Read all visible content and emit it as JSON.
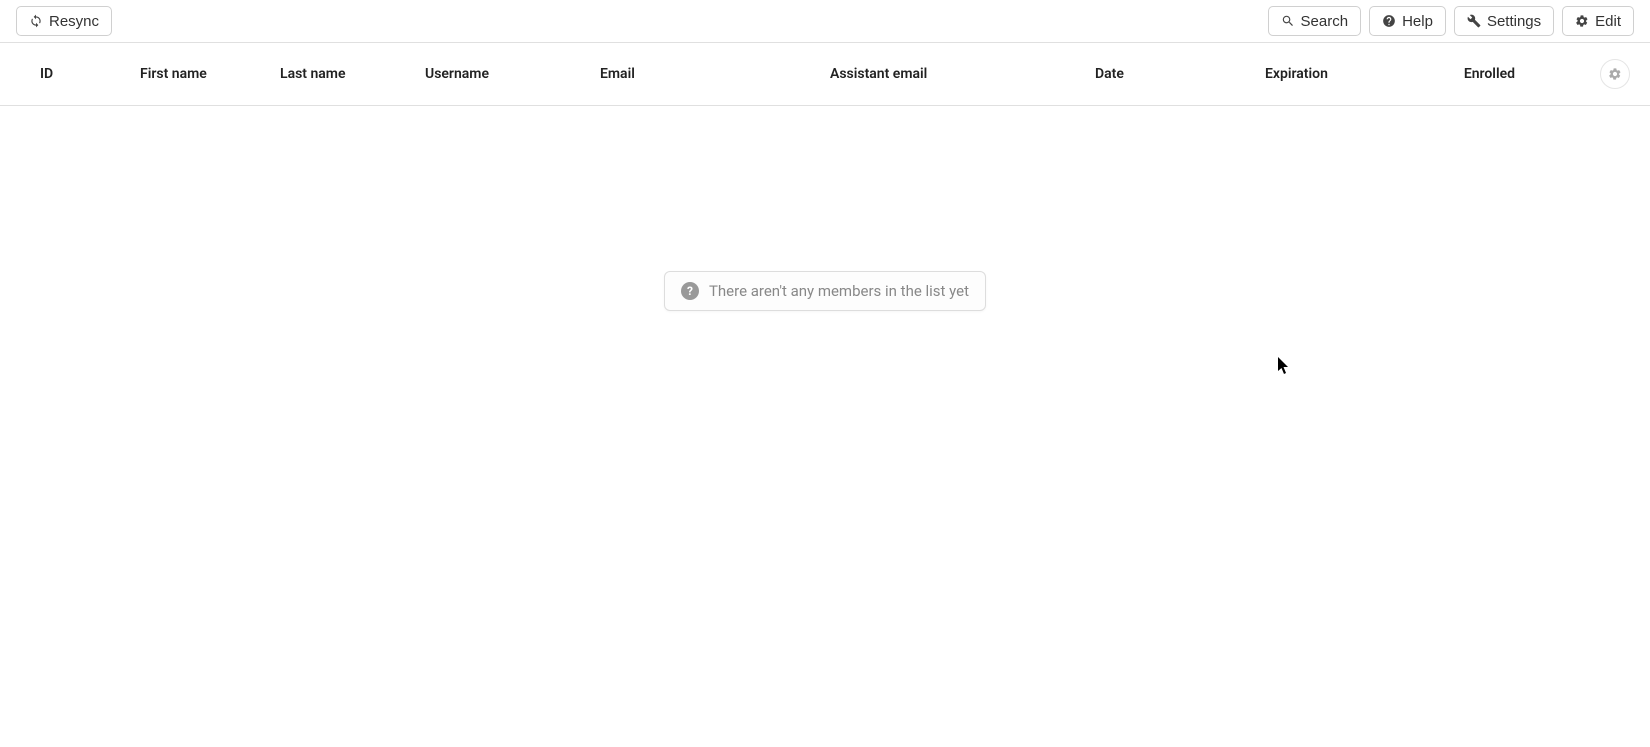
{
  "toolbar": {
    "resync": "Resync",
    "search": "Search",
    "help": "Help",
    "settings": "Settings",
    "edit": "Edit"
  },
  "columns": {
    "id": "ID",
    "first_name": "First name",
    "last_name": "Last name",
    "username": "Username",
    "email": "Email",
    "assistant_email": "Assistant email",
    "date": "Date",
    "expiration": "Expiration",
    "enrolled": "Enrolled"
  },
  "empty_state": "There aren't any members in the list yet"
}
